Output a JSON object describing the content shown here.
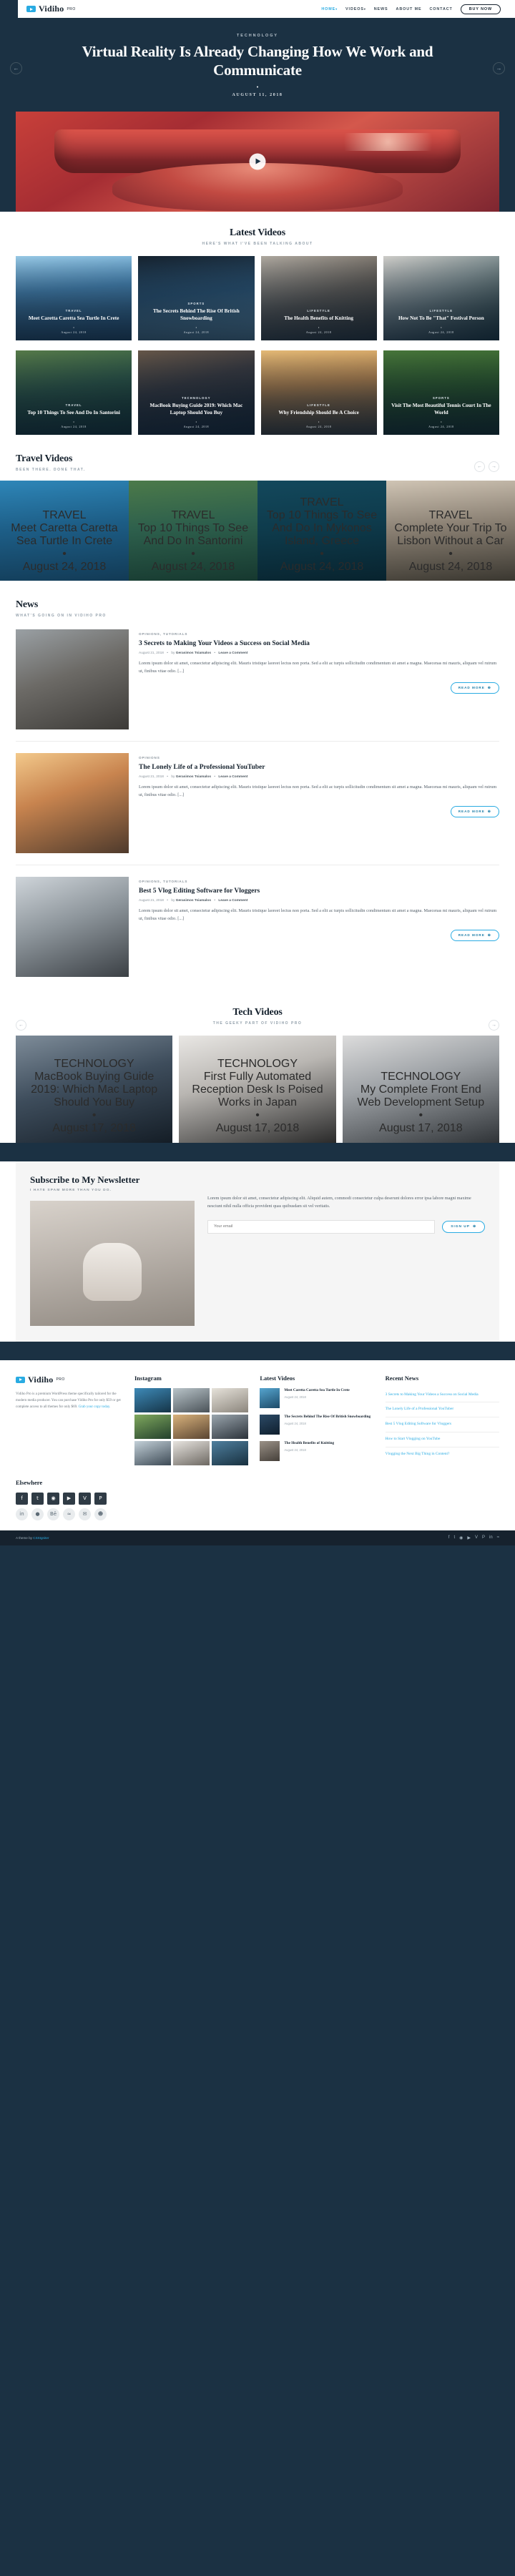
{
  "brand": {
    "name": "Vidiho",
    "sup": "PRO",
    "logo_icon": "play-logo-icon"
  },
  "nav": {
    "items": [
      {
        "label": "HOME",
        "caret": "▾",
        "active": true
      },
      {
        "label": "VIDEOS",
        "caret": "▾",
        "active": false
      },
      {
        "label": "NEWS",
        "caret": "",
        "active": false
      },
      {
        "label": "ABOUT ME",
        "caret": "",
        "active": false
      },
      {
        "label": "CONTACT",
        "caret": "",
        "active": false
      }
    ],
    "cta": "BUY NOW"
  },
  "hero": {
    "category": "TECHNOLOGY",
    "title": "Virtual Reality Is Already Changing How We Work and Communicate",
    "dot": "•",
    "date": "AUGUST 11, 2018",
    "prev_icon": "arrow-left-icon",
    "next_icon": "arrow-right-icon",
    "play_icon": "play-icon"
  },
  "latest": {
    "title": "Latest Videos",
    "subtitle": "HERE'S WHAT I'VE BEEN TALKING ABOUT",
    "cards": [
      {
        "cat": "TRAVEL",
        "title": "Meet Caretta Caretta Sea Turtle In Crete",
        "date": "August 24, 2018"
      },
      {
        "cat": "SPORTS",
        "title": "The Secrets Behind The Rise Of British Snowboarding",
        "date": "August 24, 2018"
      },
      {
        "cat": "LIFESTYLE",
        "title": "The Health Benefits of Knitting",
        "date": "August 24, 2018"
      },
      {
        "cat": "LIFESTYLE",
        "title": "How Not To Be \"That\" Festival Person",
        "date": "August 24, 2018"
      },
      {
        "cat": "TRAVEL",
        "title": "Top 10 Things To See And Do In Santorini",
        "date": "August 24, 2018"
      },
      {
        "cat": "TECHNOLOGY",
        "title": "MacBook Buying Guide 2019: Which Mac Laptop Should You Buy",
        "date": "August 24, 2018"
      },
      {
        "cat": "LIFESTYLE",
        "title": "Why Friendship Should Be A Choice",
        "date": "August 24, 2018"
      },
      {
        "cat": "SPORTS",
        "title": "Visit The Most Beautiful Tennis Court In The World",
        "date": "August 24, 2018"
      }
    ]
  },
  "travel": {
    "title": "Travel Videos",
    "subtitle": "BEEN THERE. DONE THAT.",
    "prev_icon": "arrow-left-icon",
    "next_icon": "arrow-right-icon",
    "cards": [
      {
        "cat": "TRAVEL",
        "title": "Meet Caretta Caretta Sea Turtle In Crete",
        "date": "August 24, 2018"
      },
      {
        "cat": "TRAVEL",
        "title": "Top 10 Things To See And Do In Santorini",
        "date": "August 24, 2018"
      },
      {
        "cat": "TRAVEL",
        "title": "Top 10 Things To See And Do In Mykonos Island, Greece",
        "date": "August 24, 2018"
      },
      {
        "cat": "TRAVEL",
        "title": "Complete Your Trip To Lisbon Without a Car",
        "date": "August 24, 2018"
      }
    ]
  },
  "news": {
    "title": "News",
    "subtitle": "WHAT'S GOING ON IN VIDIHO PRO",
    "read_more": "READ MORE",
    "read_more_icon": "circle-arrow-icon",
    "items": [
      {
        "cat": "OPINIONS, TUTORIALS",
        "title": "3 Secrets to Making Your Videos a Success on Social Media",
        "date": "August 21, 2018",
        "by_prefix": "by",
        "author": "Gerasimos Tsiamalos",
        "comment": "Leave a Comment",
        "excerpt": "Lorem ipsum dolor sit amet, consectetur adipiscing elit. Mauris tristique laoreet lectus non porta. Sed a elit ac turpis sollicitudin condimentum sit amet a magna. Maecenas mi mauris, aliquam vel rutrum ut, finibus vitae odio. [...]"
      },
      {
        "cat": "OPINIONS",
        "title": "The Lonely Life of a Professional YouTuber",
        "date": "August 21, 2018",
        "by_prefix": "by",
        "author": "Gerasimos Tsiamalos",
        "comment": "Leave a Comment",
        "excerpt": "Lorem ipsum dolor sit amet, consectetur adipiscing elit. Mauris tristique laoreet lectus non porta. Sed a elit ac turpis sollicitudin condimentum sit amet a magna. Maecenas mi mauris, aliquam vel rutrum ut, finibus vitae odio. [...]"
      },
      {
        "cat": "OPINIONS, TUTORIALS",
        "title": "Best 5 Vlog Editing Software for Vloggers",
        "date": "August 21, 2018",
        "by_prefix": "by",
        "author": "Gerasimos Tsiamalos",
        "comment": "Leave a Comment",
        "excerpt": "Lorem ipsum dolor sit amet, consectetur adipiscing elit. Mauris tristique laoreet lectus non porta. Sed a elit ac turpis sollicitudin condimentum sit amet a magna. Maecenas mi mauris, aliquam vel rutrum ut, finibus vitae odio. [...]"
      }
    ]
  },
  "tech": {
    "title": "Tech Videos",
    "subtitle": "THE GEEKY PART OF VIDIHO PRO",
    "prev_icon": "arrow-left-icon",
    "next_icon": "arrow-right-icon",
    "cards": [
      {
        "cat": "TECHNOLOGY",
        "title": "MacBook Buying Guide 2019: Which Mac Laptop Should You Buy",
        "date": "August 17, 2018"
      },
      {
        "cat": "TECHNOLOGY",
        "title": "First Fully Automated Reception Desk Is Poised Works in Japan",
        "date": "August 17, 2018"
      },
      {
        "cat": "TECHNOLOGY",
        "title": "My Complete Front End Web Development Setup",
        "date": "August 17, 2018"
      }
    ]
  },
  "newsletter": {
    "title": "Subscribe to My Newsletter",
    "subtitle": "I HATE SPAM MORE THAN YOU DO.",
    "text": "Lorem ipsum dolor sit amet, consectetur adipiscing elit. Aliquid autem, commodi consectetur culpa deserunt dolores error ipsa labore magni maxime nesciunt nihil nulla officia provident quas quibusdam sit vel veritatis.",
    "placeholder": "Your email",
    "button": "SIGN UP",
    "button_icon": "circle-arrow-icon"
  },
  "footer": {
    "about": {
      "brand": "Vidiho",
      "sup": "PRO",
      "text": "Vidiho Pro is a premium WordPress theme specifically tailored for the modern media producer. You can purchase Vidiho Pro for only $59 or get complete access to all themes for only $69.",
      "link": "Grab your copy today."
    },
    "instagram": {
      "title": "Instagram"
    },
    "latest_videos": {
      "title": "Latest Videos",
      "items": [
        {
          "title": "Meet Caretta Caretta Sea Turtle In Crete",
          "date": "August 24, 2018"
        },
        {
          "title": "The Secrets Behind The Rise Of British Snowboarding",
          "date": "August 24, 2018"
        },
        {
          "title": "The Health Benefits of Knitting",
          "date": "August 24, 2018"
        }
      ]
    },
    "recent_news": {
      "title": "Recent News",
      "items": [
        "3 Secrets to Making Your Videos a Success on Social Media",
        "The Lonely Life of a Professional YouTuber",
        "Best 5 Vlog Editing Software for Vloggers",
        "How to Start Vlogging on YouTube",
        "Vlogging the Next Big Thing in Content?"
      ]
    },
    "elsewhere": {
      "title": "Elsewhere",
      "socials": [
        {
          "icon": "facebook-icon",
          "glyph": "f"
        },
        {
          "icon": "twitter-icon",
          "glyph": "t"
        },
        {
          "icon": "instagram-icon",
          "glyph": "◉"
        },
        {
          "icon": "youtube-icon",
          "glyph": "▶"
        },
        {
          "icon": "vimeo-icon",
          "glyph": "V"
        },
        {
          "icon": "pinterest-icon",
          "glyph": "P"
        },
        {
          "icon": "linkedin-icon",
          "glyph": "in"
        },
        {
          "icon": "dribbble-icon",
          "glyph": "●"
        },
        {
          "icon": "behance-icon",
          "glyph": "Bē"
        },
        {
          "icon": "rss-icon",
          "glyph": "≈"
        },
        {
          "icon": "email-icon",
          "glyph": "✉"
        },
        {
          "icon": "snapchat-icon",
          "glyph": "☻"
        }
      ]
    }
  },
  "copyright": {
    "text": "A theme by",
    "link": "CSSIgniter",
    "socials": [
      "facebook-icon",
      "twitter-icon",
      "instagram-icon",
      "youtube-icon",
      "vimeo-icon",
      "pinterest-icon",
      "linkedin-icon",
      "rss-icon"
    ],
    "glyphs": [
      "f",
      "t",
      "◉",
      "▶",
      "V",
      "P",
      "in",
      "≈"
    ]
  },
  "colors": {
    "dark": "#1b3143",
    "darker": "#16222e",
    "accent": "#29abe2",
    "muted": "#8a949d"
  }
}
